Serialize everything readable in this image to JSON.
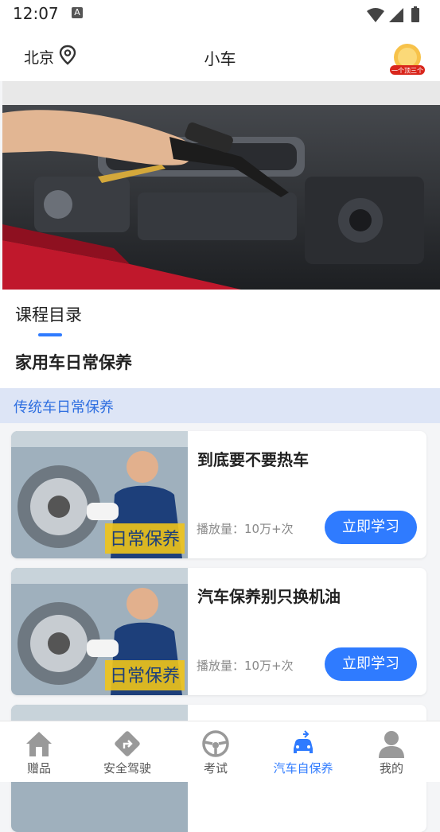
{
  "status_bar": {
    "time": "12:07",
    "notification_letter": "A"
  },
  "header": {
    "city": "北京",
    "title": "小车",
    "badge_text": "一个顶三个"
  },
  "catalog": {
    "tab_label": "课程目录",
    "category_title": "家用车日常保养"
  },
  "subcategory": {
    "label": "传统车日常保养"
  },
  "cards": [
    {
      "title": "到底要不要热车",
      "views": "播放量：10万+次",
      "button": "立即学习",
      "thumb_text": "日常保养"
    },
    {
      "title": "汽车保养别只换机油",
      "views": "播放量：10万+次",
      "button": "立即学习",
      "thumb_text": "日常保养"
    }
  ],
  "bottom_nav": [
    {
      "label": "赠品",
      "icon": "home-icon"
    },
    {
      "label": "安全驾驶",
      "icon": "road-sign-icon"
    },
    {
      "label": "考试",
      "icon": "steering-wheel-icon"
    },
    {
      "label": "汽车自保养",
      "icon": "car-service-icon",
      "active": true
    },
    {
      "label": "我的",
      "icon": "user-icon"
    }
  ],
  "colors": {
    "accent": "#2f7bff",
    "subcategory_bg": "#dde5f6"
  }
}
